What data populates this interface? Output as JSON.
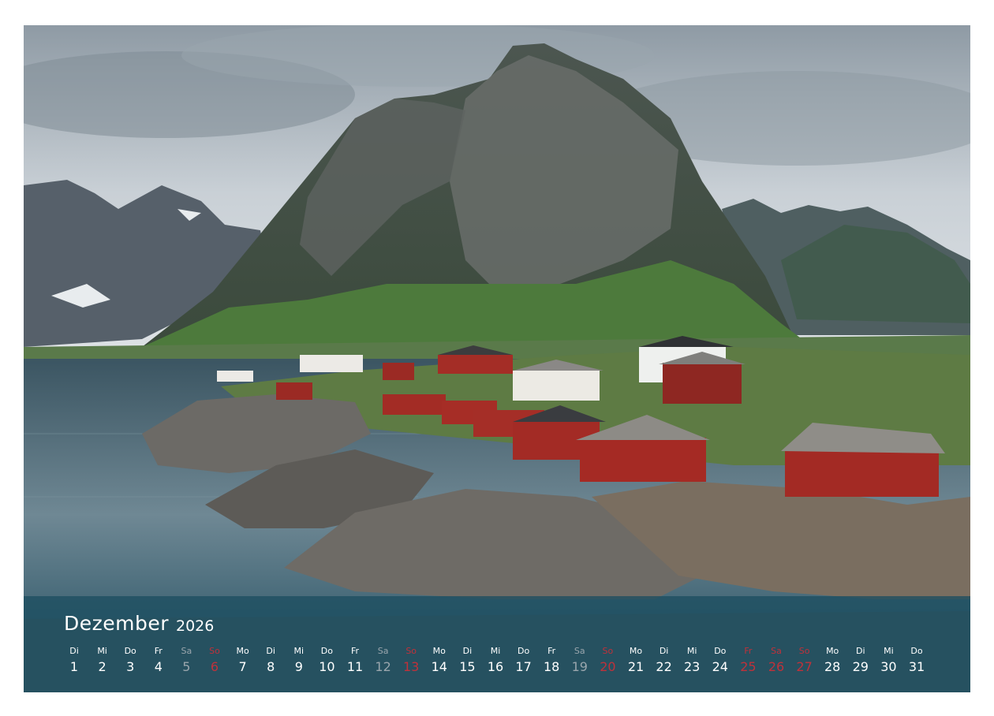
{
  "calendar": {
    "month": "Dezember",
    "year": "2026",
    "days": [
      {
        "weekday": "Di",
        "day": "1",
        "type": "weekday"
      },
      {
        "weekday": "Mi",
        "day": "2",
        "type": "weekday"
      },
      {
        "weekday": "Do",
        "day": "3",
        "type": "weekday"
      },
      {
        "weekday": "Fr",
        "day": "4",
        "type": "weekday"
      },
      {
        "weekday": "Sa",
        "day": "5",
        "type": "saturday"
      },
      {
        "weekday": "So",
        "day": "6",
        "type": "sunday"
      },
      {
        "weekday": "Mo",
        "day": "7",
        "type": "weekday"
      },
      {
        "weekday": "Di",
        "day": "8",
        "type": "weekday"
      },
      {
        "weekday": "Mi",
        "day": "9",
        "type": "weekday"
      },
      {
        "weekday": "Do",
        "day": "10",
        "type": "weekday"
      },
      {
        "weekday": "Fr",
        "day": "11",
        "type": "weekday"
      },
      {
        "weekday": "Sa",
        "day": "12",
        "type": "saturday"
      },
      {
        "weekday": "So",
        "day": "13",
        "type": "sunday"
      },
      {
        "weekday": "Mo",
        "day": "14",
        "type": "weekday"
      },
      {
        "weekday": "Di",
        "day": "15",
        "type": "weekday"
      },
      {
        "weekday": "Mi",
        "day": "16",
        "type": "weekday"
      },
      {
        "weekday": "Do",
        "day": "17",
        "type": "weekday"
      },
      {
        "weekday": "Fr",
        "day": "18",
        "type": "weekday"
      },
      {
        "weekday": "Sa",
        "day": "19",
        "type": "saturday"
      },
      {
        "weekday": "So",
        "day": "20",
        "type": "sunday"
      },
      {
        "weekday": "Mo",
        "day": "21",
        "type": "weekday"
      },
      {
        "weekday": "Di",
        "day": "22",
        "type": "weekday"
      },
      {
        "weekday": "Mi",
        "day": "23",
        "type": "weekday"
      },
      {
        "weekday": "Do",
        "day": "24",
        "type": "weekday"
      },
      {
        "weekday": "Fr",
        "day": "25",
        "type": "sunday"
      },
      {
        "weekday": "Sa",
        "day": "26",
        "type": "sunday"
      },
      {
        "weekday": "So",
        "day": "27",
        "type": "sunday"
      },
      {
        "weekday": "Mo",
        "day": "28",
        "type": "weekday"
      },
      {
        "weekday": "Di",
        "day": "29",
        "type": "weekday"
      },
      {
        "weekday": "Mi",
        "day": "30",
        "type": "weekday"
      },
      {
        "weekday": "Do",
        "day": "31",
        "type": "weekday"
      }
    ]
  },
  "colors": {
    "band": "#1c4e60",
    "weekday_text": "#ffffff",
    "saturday_text": "#9aa6ad",
    "holiday_text": "#c0313a"
  }
}
